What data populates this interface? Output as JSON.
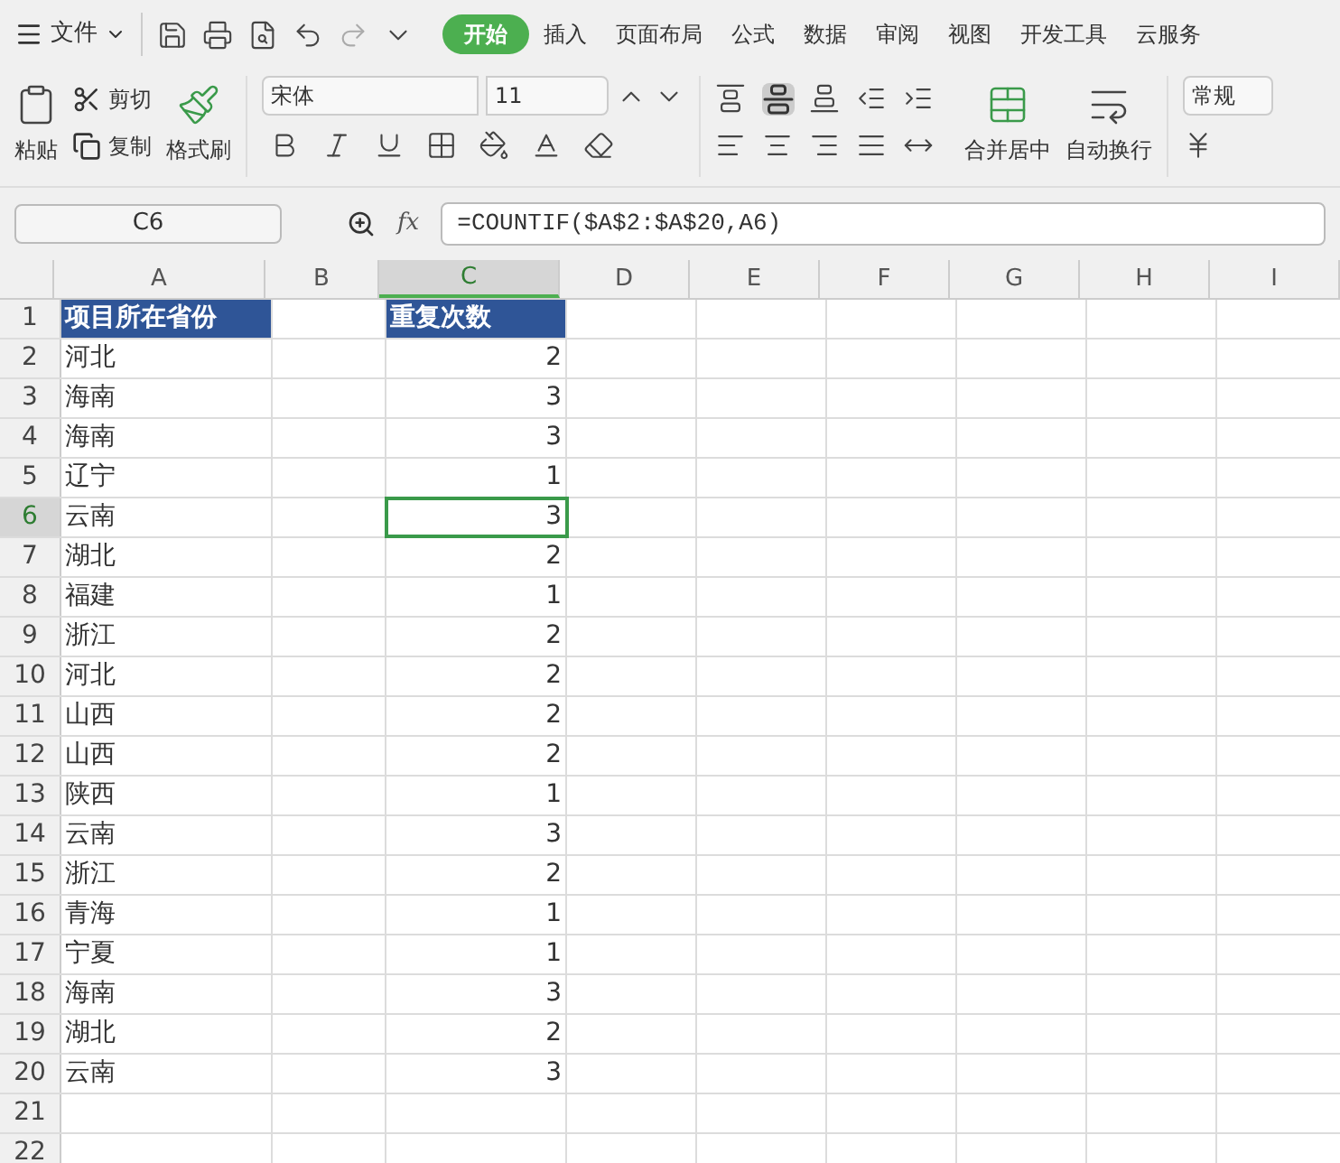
{
  "menu": {
    "file": "文件",
    "tabs": [
      {
        "label": "开始",
        "selected": true
      },
      {
        "label": "插入",
        "selected": false
      },
      {
        "label": "页面布局",
        "selected": false
      },
      {
        "label": "公式",
        "selected": false
      },
      {
        "label": "数据",
        "selected": false
      },
      {
        "label": "审阅",
        "selected": false
      },
      {
        "label": "视图",
        "selected": false
      },
      {
        "label": "开发工具",
        "selected": false
      },
      {
        "label": "云服务",
        "selected": false
      }
    ]
  },
  "ribbon": {
    "paste": "粘贴",
    "cut": "剪切",
    "copy": "复制",
    "format_painter": "格式刷",
    "font": "宋体",
    "size": "11",
    "merge": "合并居中",
    "wrap": "自动换行",
    "number_format": "常规"
  },
  "formula_bar": {
    "name_box": "C6",
    "fx_label": "fx",
    "formula": "=COUNTIF($A$2:$A$20,A6)"
  },
  "columns": [
    {
      "label": "A",
      "selected": false
    },
    {
      "label": "B",
      "selected": false
    },
    {
      "label": "C",
      "selected": true
    },
    {
      "label": "D",
      "selected": false
    },
    {
      "label": "E",
      "selected": false
    },
    {
      "label": "F",
      "selected": false
    },
    {
      "label": "G",
      "selected": false
    },
    {
      "label": "H",
      "selected": false
    },
    {
      "label": "I",
      "selected": false
    }
  ],
  "rows": [
    {
      "number": "1",
      "kind": "header",
      "selected": false,
      "cells": [
        "项目所在省份",
        "",
        "重复次数"
      ]
    },
    {
      "number": "2",
      "kind": "data",
      "selected": false,
      "cells": [
        "河北",
        "",
        "2"
      ]
    },
    {
      "number": "3",
      "kind": "data",
      "selected": false,
      "cells": [
        "海南",
        "",
        "3"
      ]
    },
    {
      "number": "4",
      "kind": "data",
      "selected": false,
      "cells": [
        "海南",
        "",
        "3"
      ]
    },
    {
      "number": "5",
      "kind": "data",
      "selected": false,
      "cells": [
        "辽宁",
        "",
        "1"
      ]
    },
    {
      "number": "6",
      "kind": "data",
      "selected": true,
      "cells": [
        "云南",
        "",
        "3"
      ]
    },
    {
      "number": "7",
      "kind": "data",
      "selected": false,
      "cells": [
        "湖北",
        "",
        "2"
      ]
    },
    {
      "number": "8",
      "kind": "data",
      "selected": false,
      "cells": [
        "福建",
        "",
        "1"
      ]
    },
    {
      "number": "9",
      "kind": "data",
      "selected": false,
      "cells": [
        "浙江",
        "",
        "2"
      ]
    },
    {
      "number": "10",
      "kind": "data",
      "selected": false,
      "cells": [
        "河北",
        "",
        "2"
      ]
    },
    {
      "number": "11",
      "kind": "data",
      "selected": false,
      "cells": [
        "山西",
        "",
        "2"
      ]
    },
    {
      "number": "12",
      "kind": "data",
      "selected": false,
      "cells": [
        "山西",
        "",
        "2"
      ]
    },
    {
      "number": "13",
      "kind": "data",
      "selected": false,
      "cells": [
        "陕西",
        "",
        "1"
      ]
    },
    {
      "number": "14",
      "kind": "data",
      "selected": false,
      "cells": [
        "云南",
        "",
        "3"
      ]
    },
    {
      "number": "15",
      "kind": "data",
      "selected": false,
      "cells": [
        "浙江",
        "",
        "2"
      ]
    },
    {
      "number": "16",
      "kind": "data",
      "selected": false,
      "cells": [
        "青海",
        "",
        "1"
      ]
    },
    {
      "number": "17",
      "kind": "data",
      "selected": false,
      "cells": [
        "宁夏",
        "",
        "1"
      ]
    },
    {
      "number": "18",
      "kind": "data",
      "selected": false,
      "cells": [
        "海南",
        "",
        "3"
      ]
    },
    {
      "number": "19",
      "kind": "data",
      "selected": false,
      "cells": [
        "湖北",
        "",
        "2"
      ]
    },
    {
      "number": "20",
      "kind": "data",
      "selected": false,
      "cells": [
        "云南",
        "",
        "3"
      ]
    },
    {
      "number": "21",
      "kind": "data",
      "selected": false,
      "cells": [
        "",
        "",
        ""
      ]
    },
    {
      "number": "22",
      "kind": "data",
      "selected": false,
      "cells": [
        "",
        "",
        ""
      ]
    }
  ]
}
